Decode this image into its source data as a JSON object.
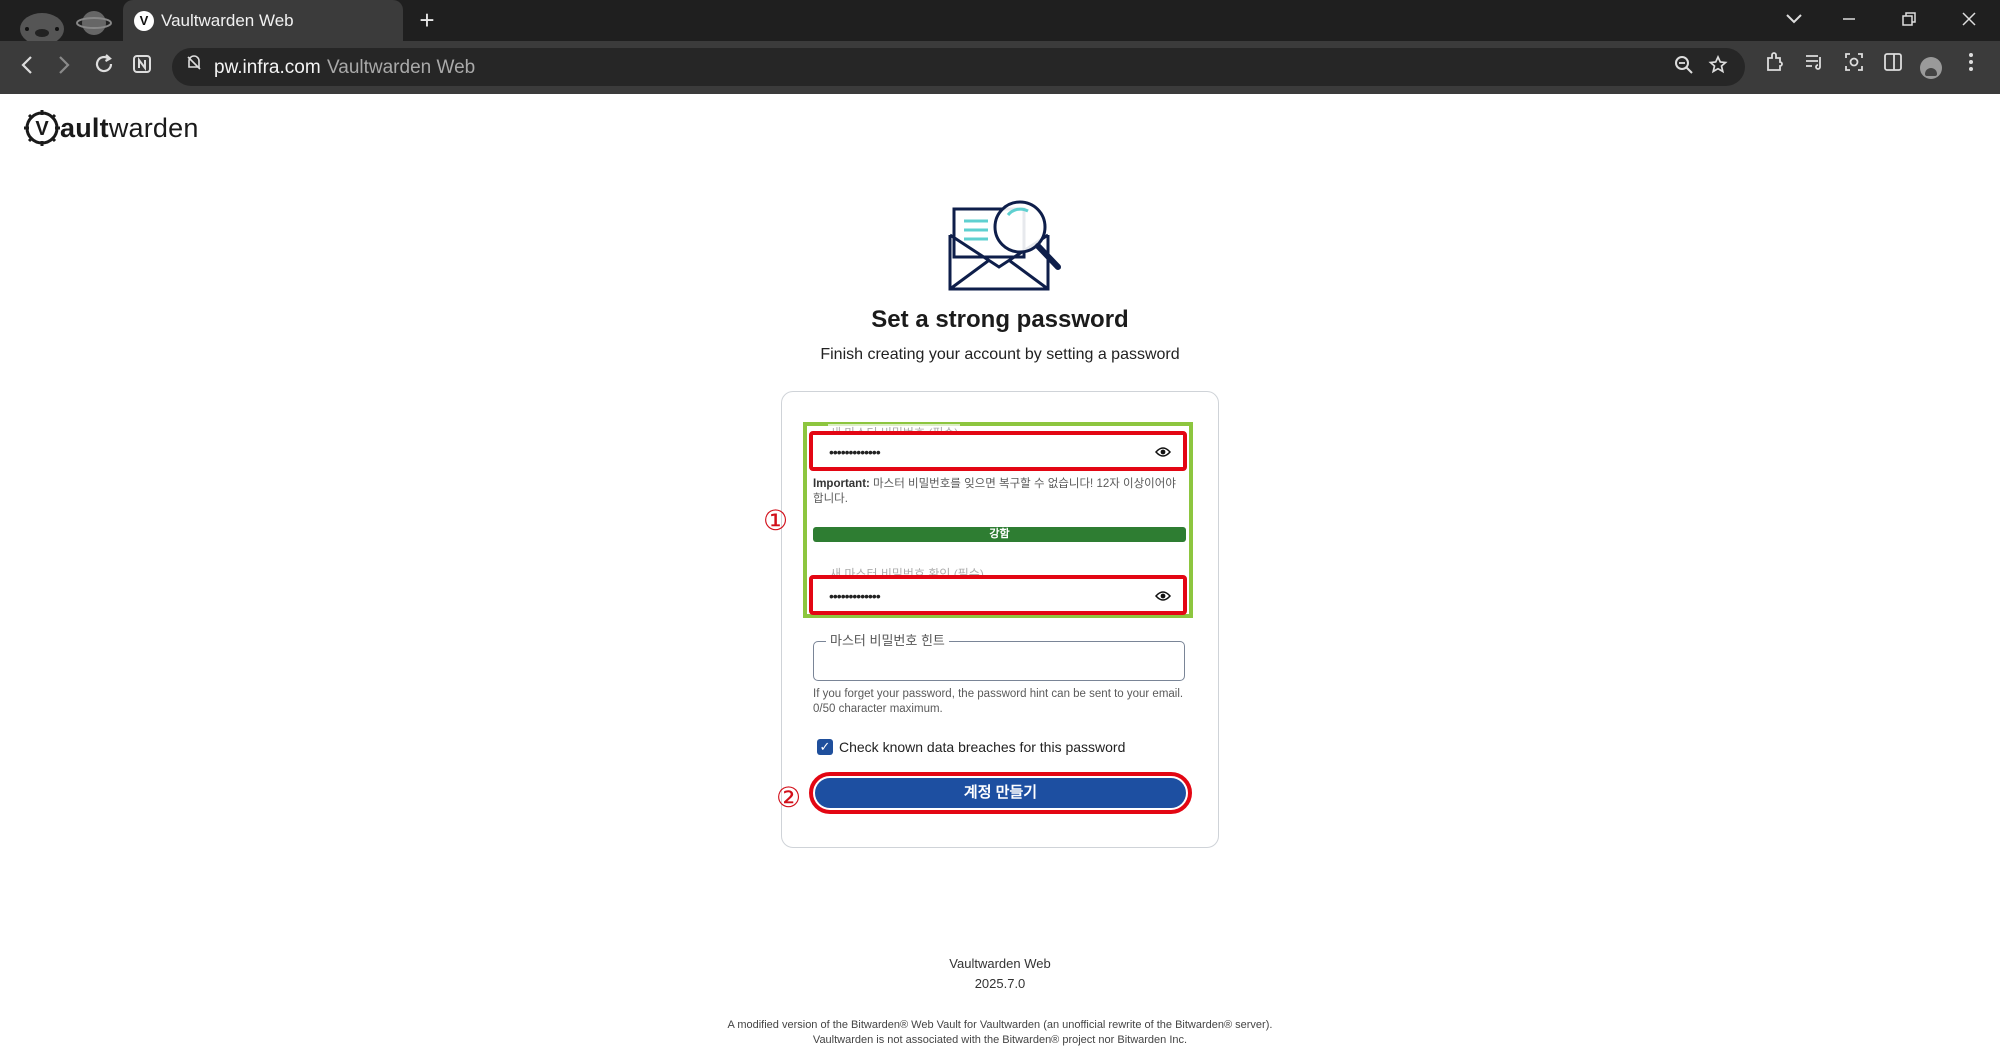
{
  "browser": {
    "tab_title": "Vaultwarden Web",
    "new_tab": "+",
    "url": "pw.infra.com",
    "url_title": "Vaultwarden Web",
    "window_controls": [
      "chevron-down-icon",
      "minimize-icon",
      "restore-icon",
      "close-icon"
    ],
    "toolbar_icons": [
      "extensions-icon",
      "reading-list-icon",
      "screenshot-icon",
      "split-view-icon",
      "profile-avatar",
      "menu-icon"
    ]
  },
  "logo": {
    "prefix": "V",
    "bold": "ault",
    "rest": "warden"
  },
  "heading": "Set a strong password",
  "subheading": "Finish creating your account by setting a password",
  "form": {
    "password_label": "새 마스터 비밀번호 (필수)",
    "password_value": "•••••••••••••",
    "important_bold": "Important:",
    "important_text": " 마스터 비밀번호를 잊으면 복구할 수 없습니다! 12자 이상이어야 합니다.",
    "strength": "강함",
    "confirm_label": "새 마스터 비밀번호 확인 (필수)",
    "confirm_value": "•••••••••••••",
    "hint_label": "마스터 비밀번호 힌트",
    "hint_value": "",
    "hint_help": "If you forget your password, the password hint can be sent to your email. 0/50 character maximum.",
    "breach_check_label": "Check known data breaches for this password",
    "breach_checked": true,
    "submit": "계정 만들기"
  },
  "annotations": {
    "marker1": "①",
    "marker2": "②"
  },
  "footer": {
    "app": "Vaultwarden Web",
    "version": "2025.7.0",
    "line1": "A modified version of the Bitwarden® Web Vault for Vaultwarden (an unofficial rewrite of the Bitwarden® server).",
    "line2": "Vaultwarden is not associated with the Bitwarden® project nor Bitwarden Inc."
  },
  "colors": {
    "primary": "#1d4fa1",
    "strength_green": "#2e7d32",
    "annotation_red": "#e30613",
    "annotation_green": "#8dc63f"
  }
}
